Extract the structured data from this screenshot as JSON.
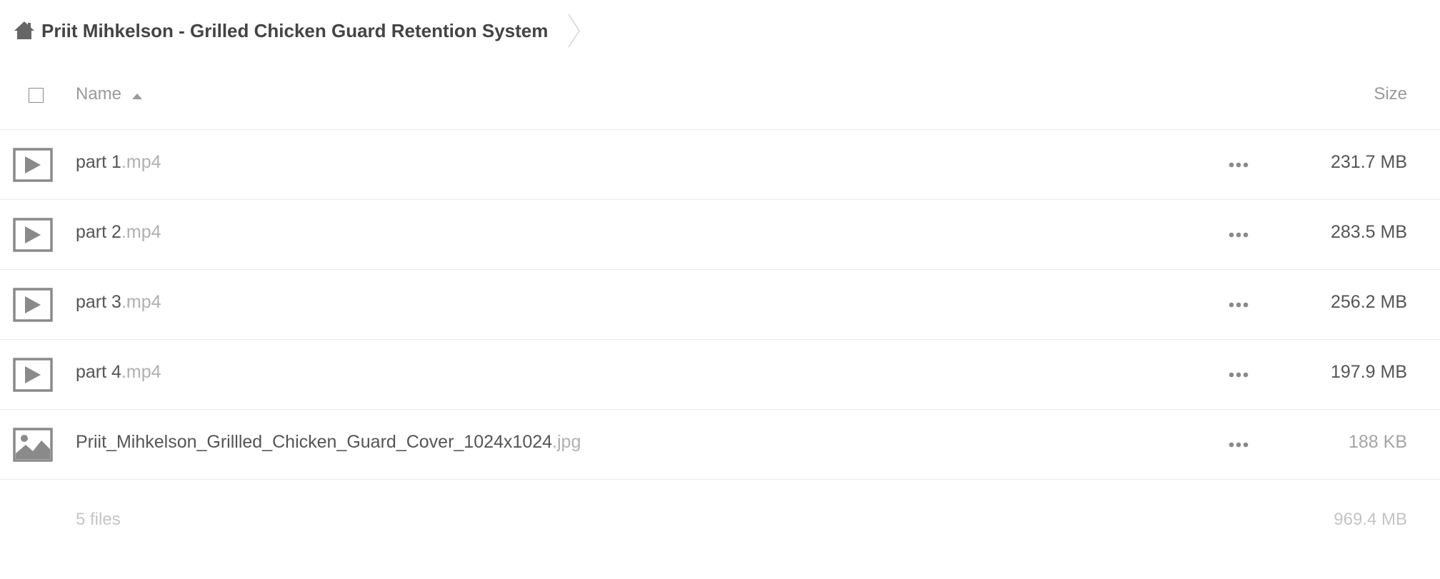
{
  "breadcrumb": {
    "home_icon": "home-icon",
    "folder_title": "Priit Mihkelson - Grilled Chicken Guard Retention System"
  },
  "header": {
    "name_label": "Name",
    "size_label": "Size",
    "sort_direction": "ascending"
  },
  "files": [
    {
      "base": "part 1",
      "ext": ".mp4",
      "size": "231.7 MB",
      "type": "video",
      "icon": "video-play-icon"
    },
    {
      "base": "part 2",
      "ext": ".mp4",
      "size": "283.5 MB",
      "type": "video",
      "icon": "video-play-icon"
    },
    {
      "base": "part 3",
      "ext": ".mp4",
      "size": "256.2 MB",
      "type": "video",
      "icon": "video-play-icon"
    },
    {
      "base": "part 4",
      "ext": ".mp4",
      "size": "197.9 MB",
      "type": "video",
      "icon": "video-play-icon"
    },
    {
      "base": "Priit_Mihkelson_Grillled_Chicken_Guard_Cover_1024x1024",
      "ext": ".jpg",
      "size": "188 KB",
      "type": "image",
      "icon": "image-icon"
    }
  ],
  "summary": {
    "count": "5 files",
    "total_size": "969.4 MB"
  },
  "colors": {
    "icon_gray": "#8a8a8a",
    "text": "#555555",
    "muted": "#b0b0b0",
    "divider": "#ececec"
  }
}
